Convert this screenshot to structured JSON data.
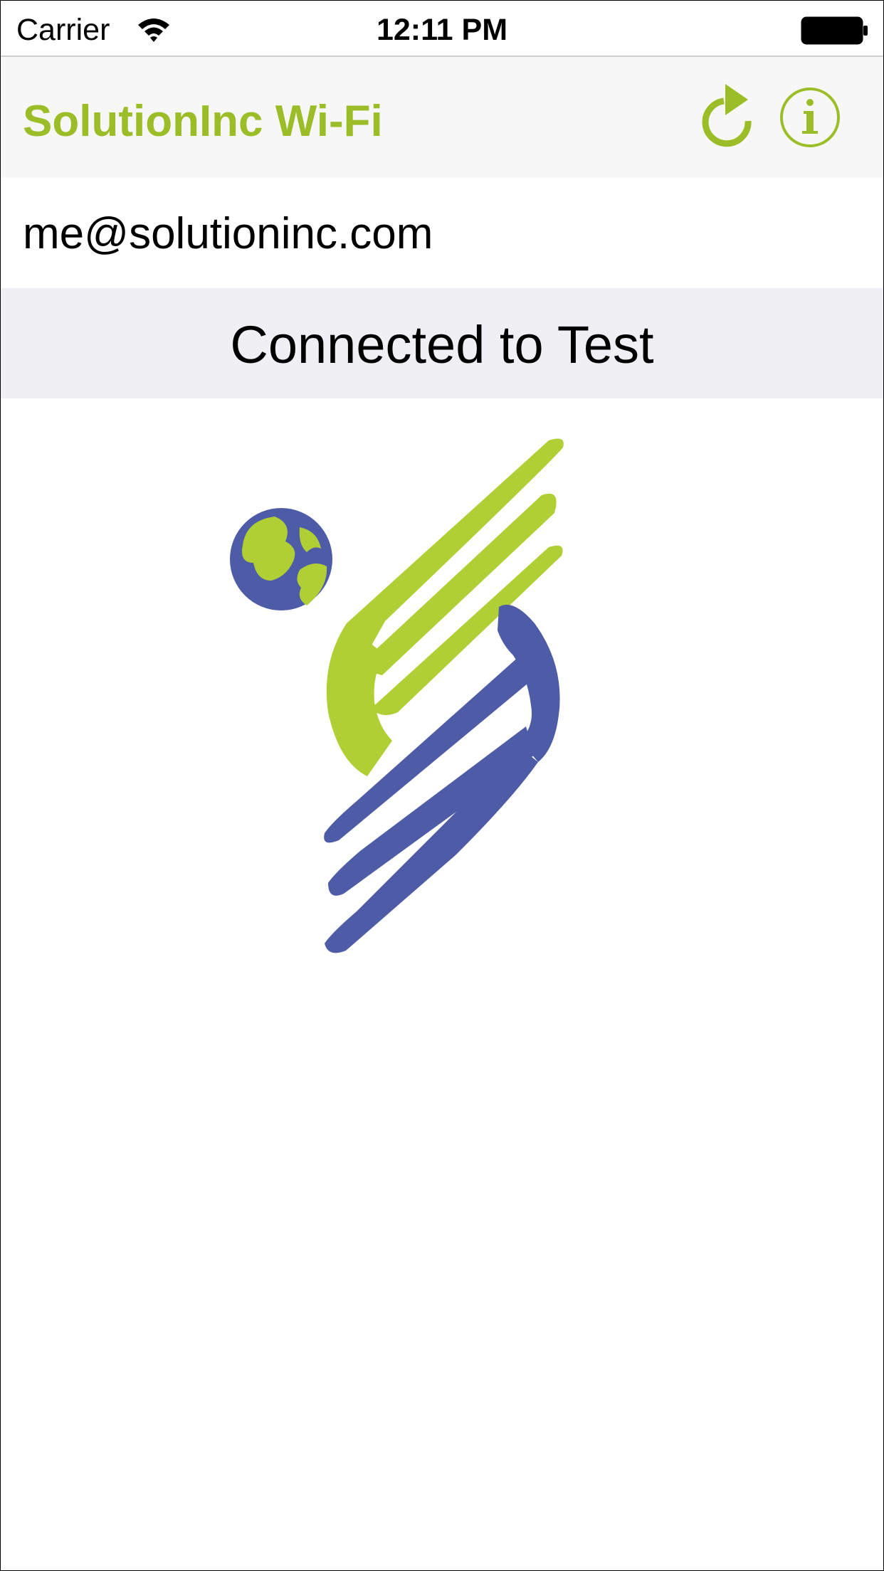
{
  "status_bar": {
    "carrier": "Carrier",
    "time": "12:11 PM",
    "icons": [
      "wifi-icon",
      "battery-icon"
    ]
  },
  "nav": {
    "title": "SolutionInc Wi-Fi",
    "buttons": [
      {
        "icon": "refresh-icon"
      },
      {
        "icon": "info-icon"
      }
    ]
  },
  "account": {
    "email": "me@solutioninc.com"
  },
  "connection": {
    "status": "Connected to Test"
  },
  "colors": {
    "brand_green": "#9bbe28",
    "logo_green": "#b0cf34",
    "logo_blue": "#4e5ca8",
    "banner_bg": "#efeff4",
    "nav_bg": "#f7f7f7"
  }
}
